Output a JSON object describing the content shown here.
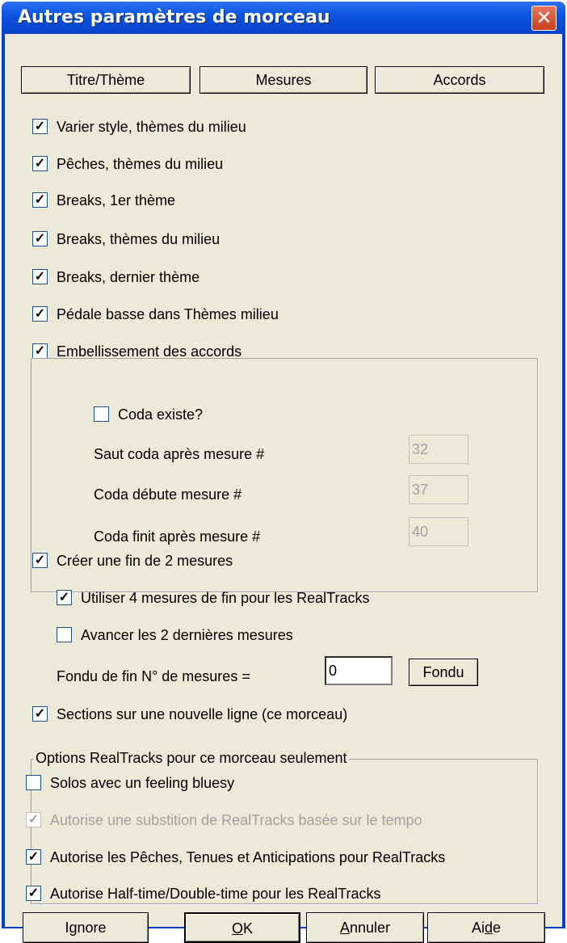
{
  "window": {
    "title": "Autres paramètres de morceau",
    "close_glyph": "✕"
  },
  "top_buttons": [
    "Titre/Thème",
    "Mesures",
    "Accords"
  ],
  "options": [
    "Varier style, thèmes du milieu",
    "Pêches, thèmes du milieu",
    "Breaks, 1er thème",
    "Breaks, thèmes du milieu",
    "Breaks, dernier thème",
    "Pédale basse dans Thèmes milieu",
    "Embellissement des accords"
  ],
  "coda": {
    "exists_label": "Coda existe?",
    "exists_checked": false,
    "jump_label": "Saut coda après mesure #",
    "jump_value": "32",
    "start_label": "Coda débute mesure #",
    "start_value": "37",
    "end_label": "Coda finit après mesure #",
    "end_value": "40"
  },
  "ending": {
    "create_label": "Créer une fin de 2 mesures",
    "use4_label": "Utiliser 4 mesures de fin pour les RealTracks",
    "advance_label": "Avancer les 2 dernières mesures",
    "fade_label": "Fondu de fin N° de mesures =",
    "fade_value": "0",
    "fade_button": "Fondu"
  },
  "sections_label": "Sections sur une nouvelle ligne (ce morceau)",
  "realtracks": {
    "legend": "Options RealTracks pour ce morceau seulement",
    "solos_label": "Solos avec un feeling bluesy",
    "substitution_label": "Autorise une substition de RealTracks basée sur le tempo",
    "pushes_label": "Autorise les Pêches, Tenues et Anticipations pour RealTracks",
    "halftime_label": "Autorise Half-time/Double-time pour les RealTracks"
  },
  "bottom_buttons": {
    "ignore": "Ignore",
    "ok_u": "O",
    "ok_rest": "K",
    "cancel_u": "A",
    "cancel_rest": "nnuler",
    "help_pre": "Ai",
    "help_u": "d",
    "help_post": "e"
  },
  "check_glyph": "✓"
}
